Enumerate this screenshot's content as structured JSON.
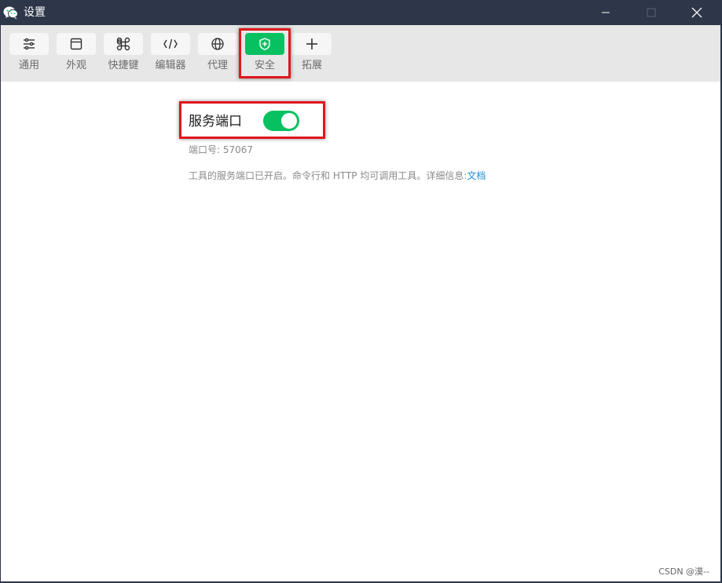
{
  "window": {
    "title": "设置",
    "app_icon": "wechat-devtools-icon",
    "controls": [
      "minimize-icon",
      "maximize-icon",
      "close-icon"
    ]
  },
  "toolbar": {
    "items": [
      {
        "label": "通用",
        "icon": "sliders-icon",
        "active": false
      },
      {
        "label": "外观",
        "icon": "window-icon",
        "active": false
      },
      {
        "label": "快捷键",
        "icon": "command-key-icon",
        "active": false
      },
      {
        "label": "编辑器",
        "icon": "code-icon",
        "active": false
      },
      {
        "label": "代理",
        "icon": "globe-icon",
        "active": false
      },
      {
        "label": "安全",
        "icon": "shield-icon",
        "active": true
      },
      {
        "label": "拓展",
        "icon": "plus-icon",
        "active": false
      }
    ]
  },
  "service_port": {
    "title": "服务端口",
    "enabled": true,
    "port_label": "端口号:",
    "port_value": "57067",
    "description": "工具的服务端口已开启。命令行和 HTTP 均可调用工具。详细信息:",
    "link_text": "文档"
  },
  "watermark": "CSDN @漠--",
  "colors": {
    "titlebar": "#2e3649",
    "accent_green": "#07c160",
    "toolbar_bg": "#e7e7e7",
    "highlight_red": "#e0161c",
    "link_blue": "#1f8fd6"
  }
}
